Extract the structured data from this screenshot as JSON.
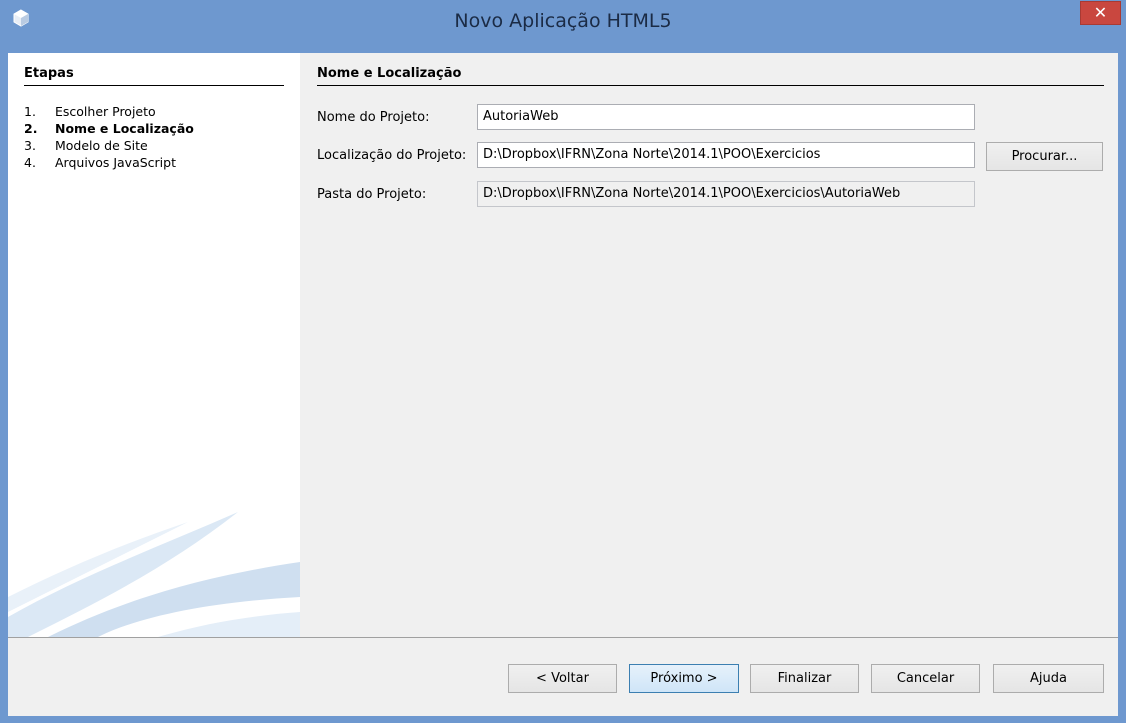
{
  "window": {
    "title": "Novo Aplicação HTML5",
    "close_label": "✕"
  },
  "steps": {
    "title": "Etapas",
    "items": [
      {
        "num": "1.",
        "label": "Escolher Projeto"
      },
      {
        "num": "2.",
        "label": "Nome e Localização"
      },
      {
        "num": "3.",
        "label": "Modelo de Site"
      },
      {
        "num": "4.",
        "label": "Arquivos JavaScript"
      }
    ],
    "active_index": 1
  },
  "form": {
    "section_title": "Nome e Localização",
    "project_name_label": "Nome do Projeto:",
    "project_name_value": "AutoriaWeb",
    "project_location_label": "Localização do Projeto:",
    "project_location_value": "D:\\Dropbox\\IFRN\\Zona Norte\\2014.1\\POO\\Exercicios",
    "browse_label": "Procurar...",
    "project_folder_label": "Pasta do Projeto:",
    "project_folder_value": "D:\\Dropbox\\IFRN\\Zona Norte\\2014.1\\POO\\Exercicios\\AutoriaWeb"
  },
  "buttons": {
    "back": "< Voltar",
    "next": "Próximo >",
    "finish": "Finalizar",
    "cancel": "Cancelar",
    "help": "Ajuda"
  },
  "colors": {
    "titlebar": "#6e98cf",
    "close": "#c9473f",
    "default_button_border": "#3c7fb1"
  }
}
